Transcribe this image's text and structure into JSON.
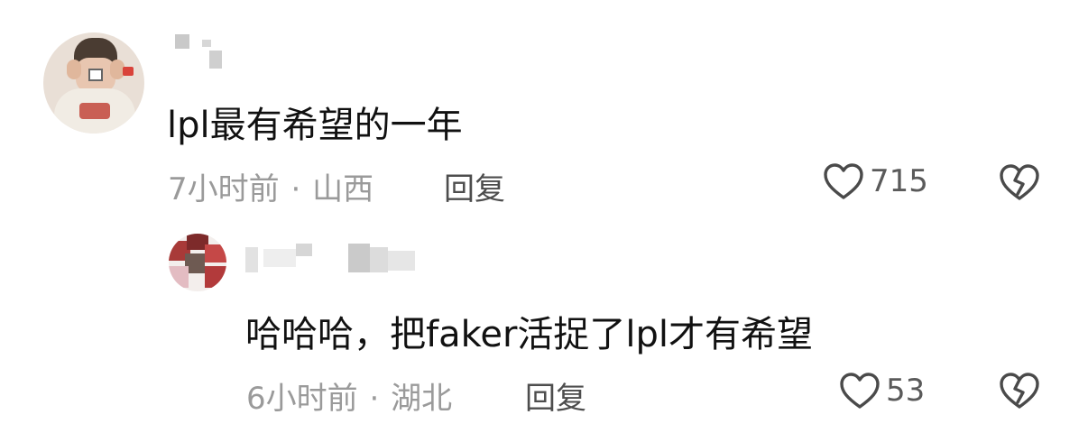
{
  "comments": [
    {
      "text": "lpl最有希望的一年",
      "time": "7小时前",
      "separator": "·",
      "location": "山西",
      "reply_label": "回复",
      "likes": "715"
    },
    {
      "text": "哈哈哈，把faker活捉了lpl才有希望",
      "time": "6小时前",
      "separator": "·",
      "location": "湖北",
      "reply_label": "回复",
      "likes": "53"
    }
  ],
  "icons": {
    "like": "heart-outline-icon",
    "dislike": "broken-heart-icon"
  },
  "colors": {
    "text": "#111111",
    "meta": "#9a9a9a",
    "reply": "#4d4d4d",
    "icon": "#4a4a4a"
  }
}
